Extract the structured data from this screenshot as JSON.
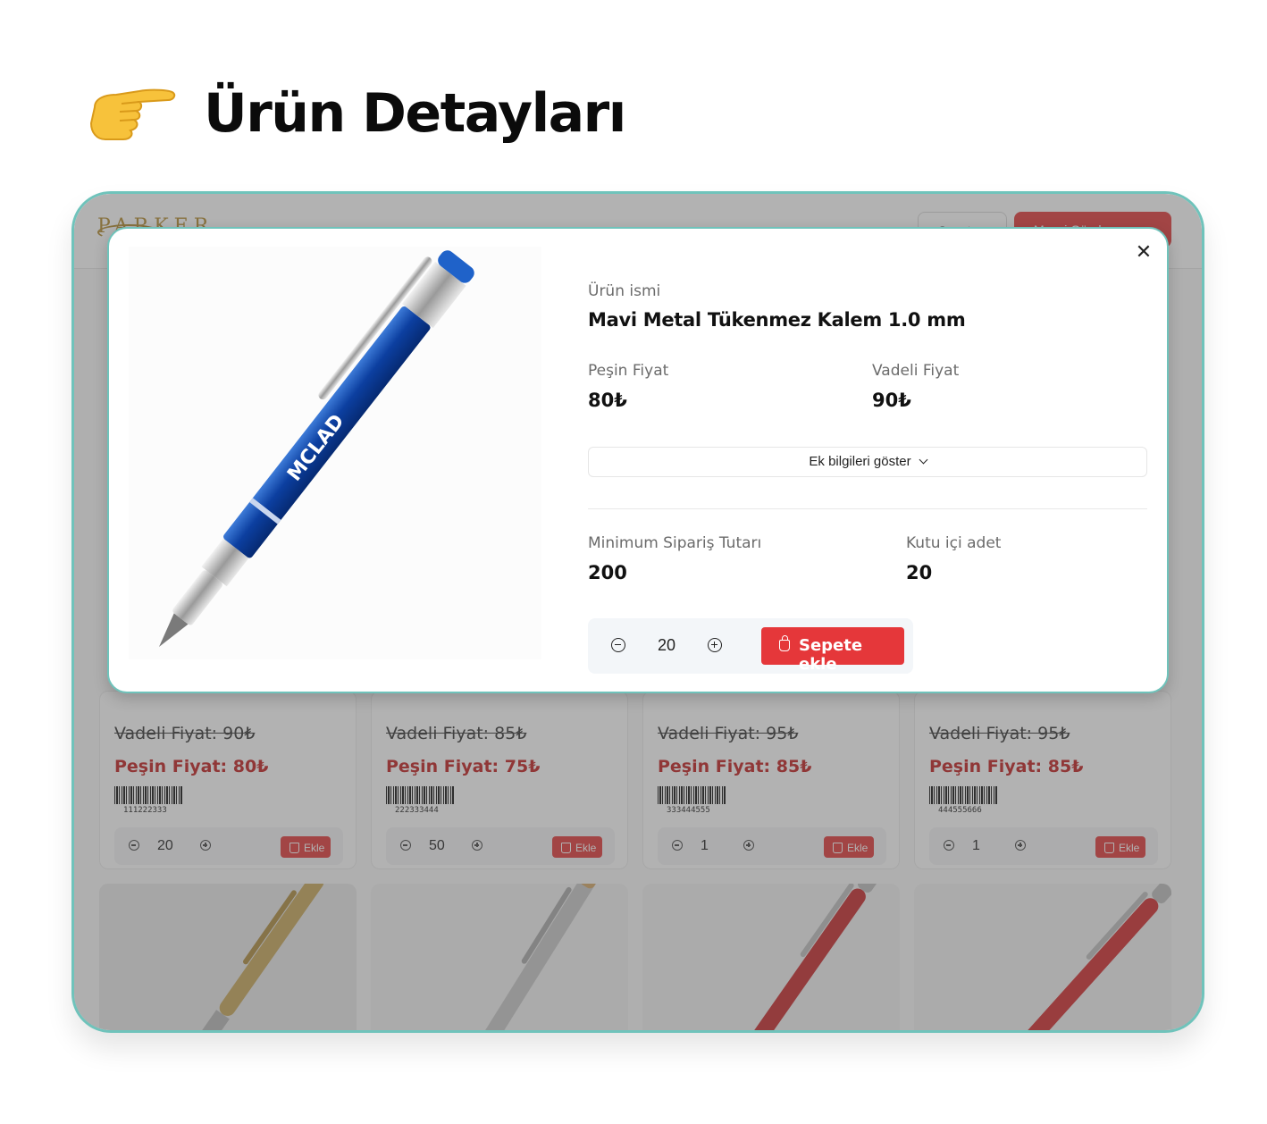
{
  "heading": {
    "icon": "pointing-hand-icon",
    "title": "Ürün Detayları"
  },
  "app": {
    "logo": "PARKER",
    "cart_label": "Sepet",
    "order_label": "Mesaj Gönder"
  },
  "cards": [
    {
      "vadeli": "Vadeli Fiyat: 90₺",
      "pesin": "Peşin Fiyat: 80₺",
      "barcode": "111222333",
      "qty": "20",
      "add_label": "Ekle"
    },
    {
      "vadeli": "Vadeli Fiyat: 85₺",
      "pesin": "Peşin Fiyat: 75₺",
      "barcode": "222333444",
      "qty": "50",
      "add_label": "Ekle"
    },
    {
      "vadeli": "Vadeli Fiyat: 95₺",
      "pesin": "Peşin Fiyat: 85₺",
      "barcode": "333444555",
      "qty": "1",
      "add_label": "Ekle"
    },
    {
      "vadeli": "Vadeli Fiyat: 95₺",
      "pesin": "Peşin Fiyat: 85₺",
      "barcode": "444555666",
      "qty": "1",
      "add_label": "Ekle"
    }
  ],
  "modal": {
    "close_icon": "close-icon",
    "image_text": "MCLAD",
    "name_label": "Ürün ismi",
    "name": "Mavi Metal Tükenmez Kalem 1.0 mm",
    "pesin_label": "Peşin Fiyat",
    "pesin_value": "80₺",
    "vadeli_label": "Vadeli Fiyat",
    "vadeli_value": "90₺",
    "more_info": "Ek bilgileri göster",
    "min_label": "Minimum Sipariş Tutarı",
    "min_value": "200",
    "box_label": "Kutu içi adet",
    "box_value": "20",
    "qty": "20",
    "add_to_cart": "Sepete ekle"
  },
  "colors": {
    "accent": "#e5373a",
    "frame_border": "#6fc3bb",
    "price_red": "#c21f1f"
  }
}
